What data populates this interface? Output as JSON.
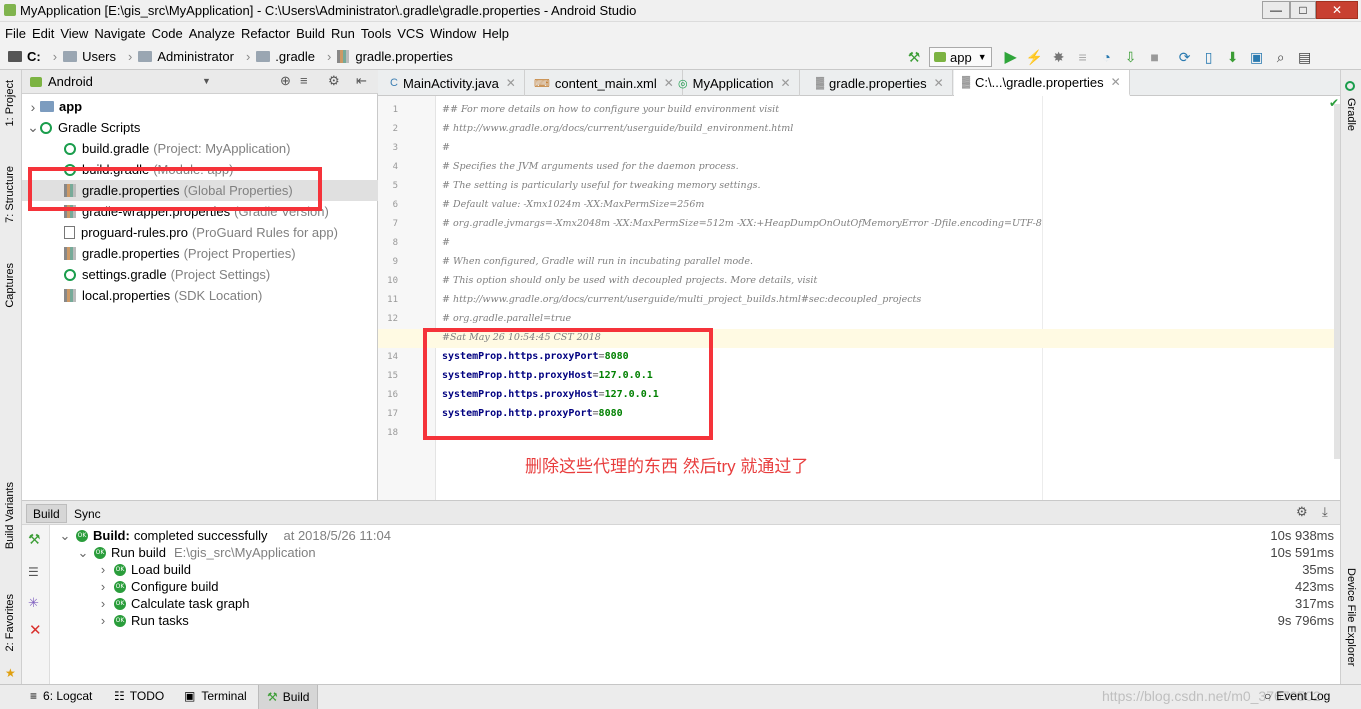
{
  "window": {
    "title": "MyApplication [E:\\gis_src\\MyApplication] - C:\\Users\\Administrator\\.gradle\\gradle.properties - Android Studio",
    "minimize": "—",
    "maximize": "□",
    "close": "✕"
  },
  "menu": [
    "File",
    "Edit",
    "View",
    "Navigate",
    "Code",
    "Analyze",
    "Refactor",
    "Build",
    "Run",
    "Tools",
    "VCS",
    "Window",
    "Help"
  ],
  "breadcrumb": [
    "C:",
    "Users",
    "Administrator",
    ".gradle",
    "gradle.properties"
  ],
  "toolbar": {
    "run_config": "app"
  },
  "left_tool_windows": {
    "project": "1: Project",
    "structure": "7: Structure",
    "captures": "Captures",
    "build_variants": "Build Variants",
    "favorites": "2: Favorites"
  },
  "right_tool_windows": {
    "gradle": "Gradle",
    "device_file_explorer": "Device File Explorer"
  },
  "project_panel": {
    "view": "Android",
    "tree": [
      {
        "label": "app",
        "sub": ""
      },
      {
        "label": "Gradle Scripts",
        "sub": ""
      },
      {
        "label": "build.gradle",
        "sub": "(Project: MyApplication)"
      },
      {
        "label": "build.gradle",
        "sub": "(Module: app)"
      },
      {
        "label": "gradle.properties",
        "sub": "(Global Properties)"
      },
      {
        "label": "gradle-wrapper.properties",
        "sub": "(Gradle Version)"
      },
      {
        "label": "proguard-rules.pro",
        "sub": "(ProGuard Rules for app)"
      },
      {
        "label": "gradle.properties",
        "sub": "(Project Properties)"
      },
      {
        "label": "settings.gradle",
        "sub": "(Project Settings)"
      },
      {
        "label": "local.properties",
        "sub": "(SDK Location)"
      }
    ]
  },
  "editor": {
    "tabs": [
      "MainActivity.java",
      "content_main.xml",
      "MyApplication",
      "gradle.properties",
      "C:\\...\\gradle.properties"
    ],
    "lines": [
      {
        "n": "1",
        "text": "## For more details on how to configure your build environment visit"
      },
      {
        "n": "2",
        "text": "# http://www.gradle.org/docs/current/userguide/build_environment.html"
      },
      {
        "n": "3",
        "text": "#"
      },
      {
        "n": "4",
        "text": "# Specifies the JVM arguments used for the daemon process."
      },
      {
        "n": "5",
        "text": "# The setting is particularly useful for tweaking memory settings."
      },
      {
        "n": "6",
        "text": "# Default value: -Xmx1024m -XX:MaxPermSize=256m"
      },
      {
        "n": "7",
        "text": "# org.gradle.jvmargs=-Xmx2048m -XX:MaxPermSize=512m -XX:+HeapDumpOnOutOfMemoryError -Dfile.encoding=UTF-8"
      },
      {
        "n": "8",
        "text": "#"
      },
      {
        "n": "9",
        "text": "# When configured, Gradle will run in incubating parallel mode."
      },
      {
        "n": "10",
        "text": "# This option should only be used with decoupled projects. More details, visit"
      },
      {
        "n": "11",
        "text": "# http://www.gradle.org/docs/current/userguide/multi_project_builds.html#sec:decoupled_projects"
      },
      {
        "n": "12",
        "text": "# org.gradle.parallel=true"
      },
      {
        "n": "13",
        "text": "#Sat May 26 10:54:45 CST 2018"
      },
      {
        "n": "14",
        "key": "systemProp.https.proxyPort",
        "value": "8080"
      },
      {
        "n": "15",
        "key": "systemProp.http.proxyHost",
        "value": "127.0.0.1"
      },
      {
        "n": "16",
        "key": "systemProp.https.proxyHost",
        "value": "127.0.0.1"
      },
      {
        "n": "17",
        "key": "systemProp.http.proxyPort",
        "value": "8080"
      },
      {
        "n": "18",
        "text": ""
      }
    ],
    "annotation": "删除这些代理的东西 然后try 就通过了"
  },
  "build_panel": {
    "tabs": [
      "Build",
      "Sync"
    ],
    "rows": [
      {
        "label": "Build:",
        "text": "completed successfully",
        "extra": "at 2018/5/26 11:04",
        "time": "10s 938ms"
      },
      {
        "label": "Run build",
        "text": "",
        "extra": "E:\\gis_src\\MyApplication",
        "time": "10s 591ms"
      },
      {
        "label": "Load build",
        "text": "",
        "extra": "",
        "time": "35ms"
      },
      {
        "label": "Configure build",
        "text": "",
        "extra": "",
        "time": "423ms"
      },
      {
        "label": "Calculate task graph",
        "text": "",
        "extra": "",
        "time": "317ms"
      },
      {
        "label": "Run tasks",
        "text": "",
        "extra": "",
        "time": "9s 796ms"
      }
    ],
    "ok_badge": "OK"
  },
  "statusbar": {
    "items": [
      "6: Logcat",
      "TODO",
      "Terminal",
      "Build"
    ],
    "right": "Event Log",
    "watermark": "https://blog.csdn.net/m0_37670502"
  },
  "colors": {
    "accent_red": "#f5333a",
    "annotation_red": "#e83d3d",
    "key_blue": "#000080",
    "value_green": "#008000"
  }
}
